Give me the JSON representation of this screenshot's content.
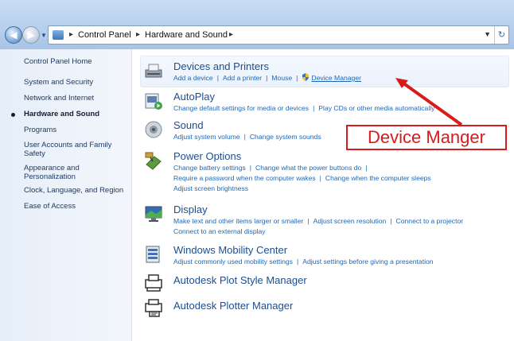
{
  "address_bar": {
    "path": [
      "Control Panel",
      "Hardware and Sound"
    ],
    "refresh_glyph": "↻"
  },
  "left_nav": {
    "items": [
      {
        "label": "Control Panel Home"
      },
      {
        "label": "System and Security"
      },
      {
        "label": "Network and Internet"
      },
      {
        "label": "Hardware and Sound",
        "active": true
      },
      {
        "label": "Programs"
      },
      {
        "label": "User Accounts and Family Safety"
      },
      {
        "label": "Appearance and Personalization"
      },
      {
        "label": "Clock, Language, and Region"
      },
      {
        "label": "Ease of Access"
      }
    ]
  },
  "categories": [
    {
      "title": "Devices and Printers",
      "icon": "printer-icon",
      "links": [
        [
          "Add a device",
          "Add a printer",
          "Mouse",
          "Device Manager"
        ]
      ]
    },
    {
      "title": "AutoPlay",
      "icon": "autoplay-icon",
      "links": [
        [
          "Change default settings for media or devices",
          "Play CDs or other media automatically"
        ]
      ]
    },
    {
      "title": "Sound",
      "icon": "speaker-icon",
      "links": [
        [
          "Adjust system volume",
          "Change system sounds"
        ]
      ]
    },
    {
      "title": "Power Options",
      "icon": "power-icon",
      "links": [
        [
          "Change battery settings",
          "Change what the power buttons do"
        ],
        [
          "Require a password when the computer wakes",
          "Change when the computer sleeps"
        ],
        [
          "Adjust screen brightness"
        ]
      ]
    },
    {
      "title": "Display",
      "icon": "monitor-icon",
      "links": [
        [
          "Make text and other items larger or smaller",
          "Adjust screen resolution",
          "Connect to a projector"
        ],
        [
          "Connect to an external display"
        ]
      ]
    },
    {
      "title": "Windows Mobility Center",
      "icon": "mobility-icon",
      "links": [
        [
          "Adjust commonly used mobility settings",
          "Adjust settings before giving a presentation"
        ]
      ]
    },
    {
      "title": "Autodesk Plot Style Manager",
      "icon": "plotter-style-icon",
      "links": []
    },
    {
      "title": "Autodesk Plotter Manager",
      "icon": "plotter-icon",
      "links": []
    }
  ],
  "callout": {
    "text": "Device Manger",
    "color": "#d81b1b"
  },
  "colors": {
    "link": "#1f67b5",
    "title": "#1d4e8f",
    "nav_text": "#1e3a66"
  }
}
